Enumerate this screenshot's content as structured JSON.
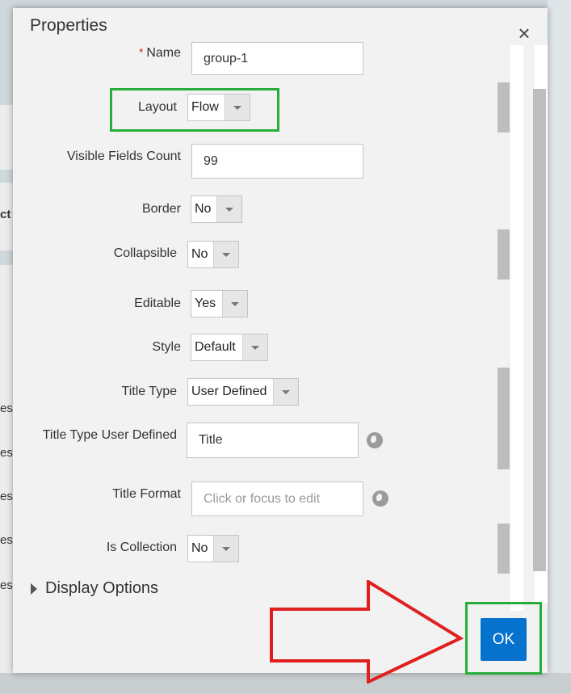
{
  "background": {
    "fragments": [
      "ct",
      "est",
      "est",
      "est",
      "est",
      "est"
    ]
  },
  "dialog": {
    "title": "Properties",
    "close_icon": "close-icon",
    "fields": {
      "name": {
        "label": "Name",
        "required_mark": "*",
        "value": "group-1"
      },
      "layout": {
        "label": "Layout",
        "value": "Flow"
      },
      "visible_fields_count": {
        "label": "Visible Fields Count",
        "value": "99"
      },
      "border": {
        "label": "Border",
        "value": "No"
      },
      "collapsible": {
        "label": "Collapsible",
        "value": "No"
      },
      "editable": {
        "label": "Editable",
        "value": "Yes"
      },
      "style": {
        "label": "Style",
        "value": "Default"
      },
      "title_type": {
        "label": "Title Type",
        "value": "User Defined"
      },
      "title_type_user_defined": {
        "label": "Title Type User Defined",
        "value": "Title",
        "icon": "globe-icon"
      },
      "title_format": {
        "label": "Title Format",
        "placeholder": "Click or focus to edit",
        "icon": "globe-icon"
      },
      "is_collection": {
        "label": "Is Collection",
        "value": "No"
      }
    },
    "display_options": "Display Options",
    "ok_label": "OK"
  },
  "colors": {
    "highlight_box": "#27ae3a",
    "arrow": "#e02020",
    "ok_button": "#0572ce"
  }
}
